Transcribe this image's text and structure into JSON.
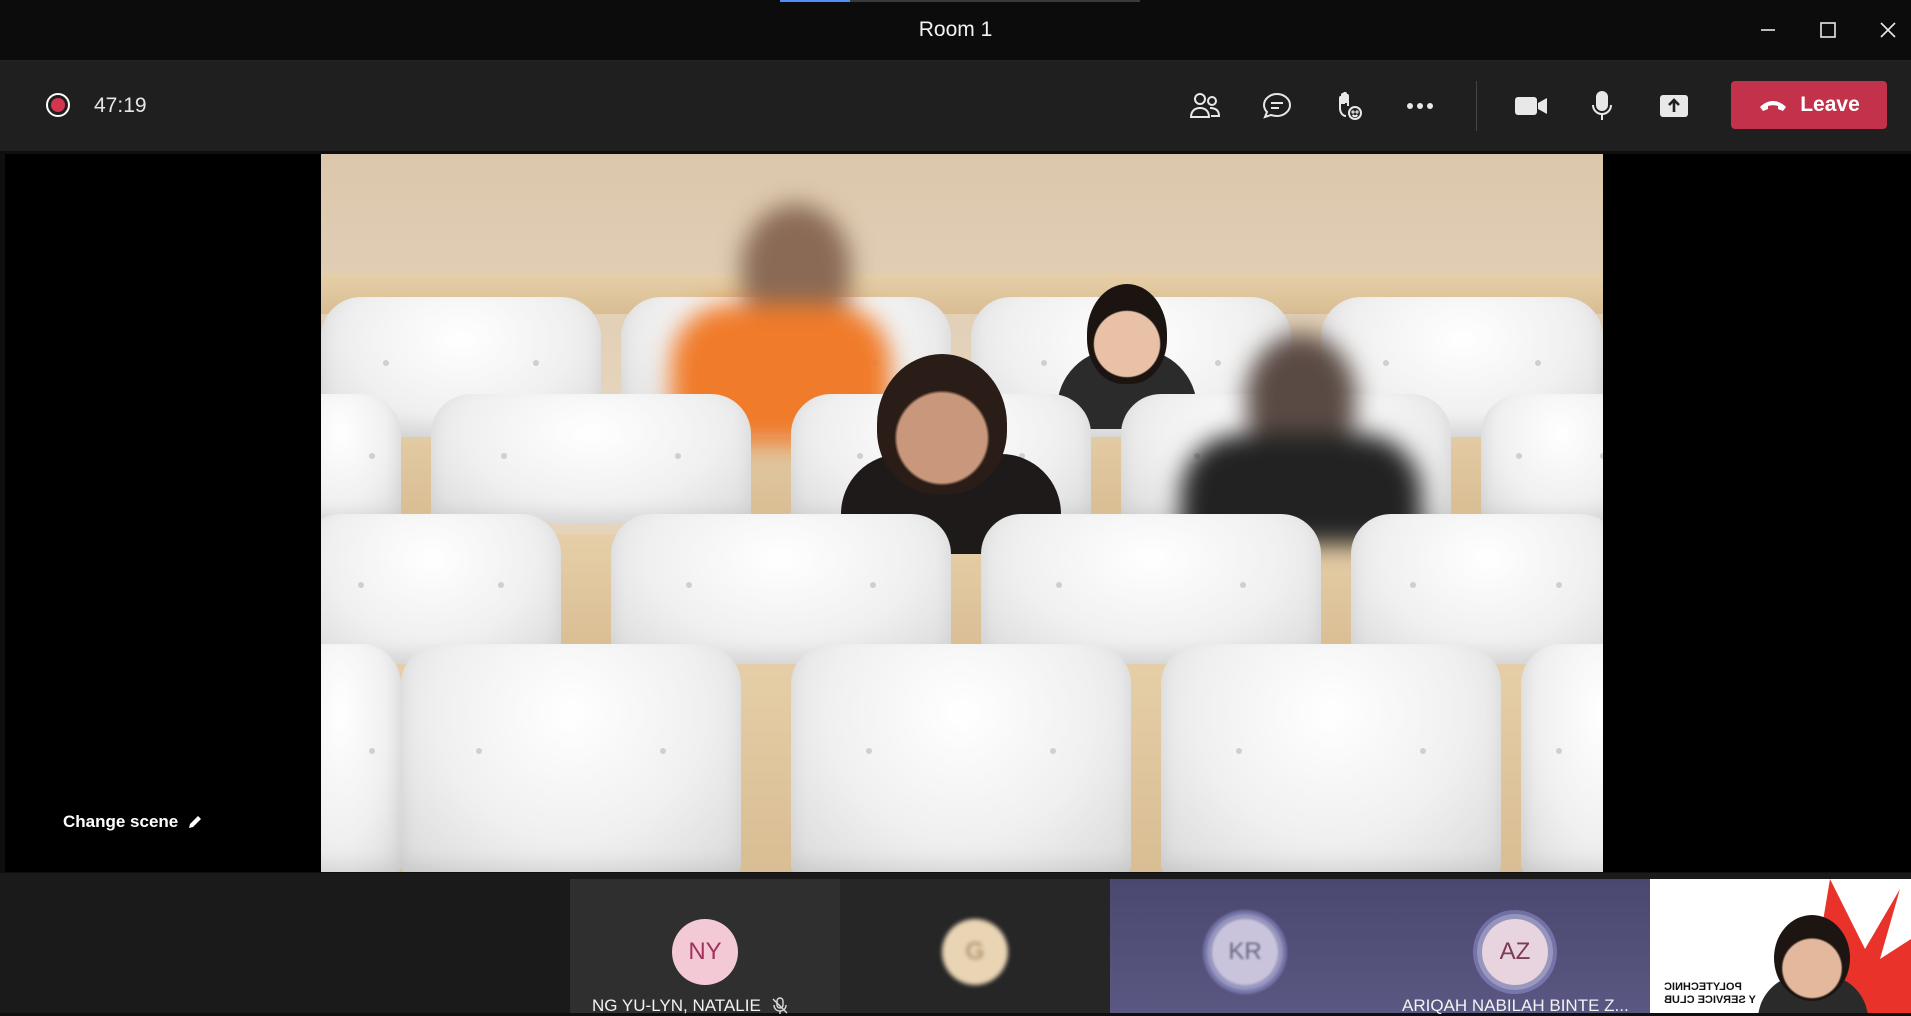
{
  "window": {
    "title": "Room 1",
    "minimize_icon": "minimize-icon",
    "maximize_icon": "maximize-icon",
    "close_icon": "close-icon"
  },
  "toolbar": {
    "timer": "47:19",
    "recording_color": "#d4364f",
    "leave_label": "Leave",
    "leave_color": "#c4314b",
    "icons": [
      "people-icon",
      "chat-icon",
      "reactions-icon",
      "more-icon",
      "camera-icon",
      "microphone-icon",
      "share-icon"
    ]
  },
  "stage": {
    "change_scene_label": "Change scene"
  },
  "participants": [
    {
      "initials": "NY",
      "name": "NG YU-LYN, NATALIE",
      "muted": true,
      "avatar_bg": "#f3c9d6",
      "avatar_fg": "#a3325a"
    },
    {
      "initials": "G",
      "name": "",
      "muted": false,
      "avatar_bg": "#e9d4b4",
      "avatar_fg": "#9a7c53"
    },
    {
      "initials": "KR",
      "name": "",
      "muted": false,
      "avatar_bg": "#c9c4dc",
      "avatar_fg": "#6a6585"
    },
    {
      "initials": "AZ",
      "name": "ARIQAH NABILAH BINTE Z...",
      "muted": false,
      "avatar_bg": "#e8d4de",
      "avatar_fg": "#7c3a5a"
    }
  ],
  "self_view": {
    "background_text_line1": "POLYTECHNIC",
    "background_text_line2": "Y SERVICE CLUB"
  }
}
